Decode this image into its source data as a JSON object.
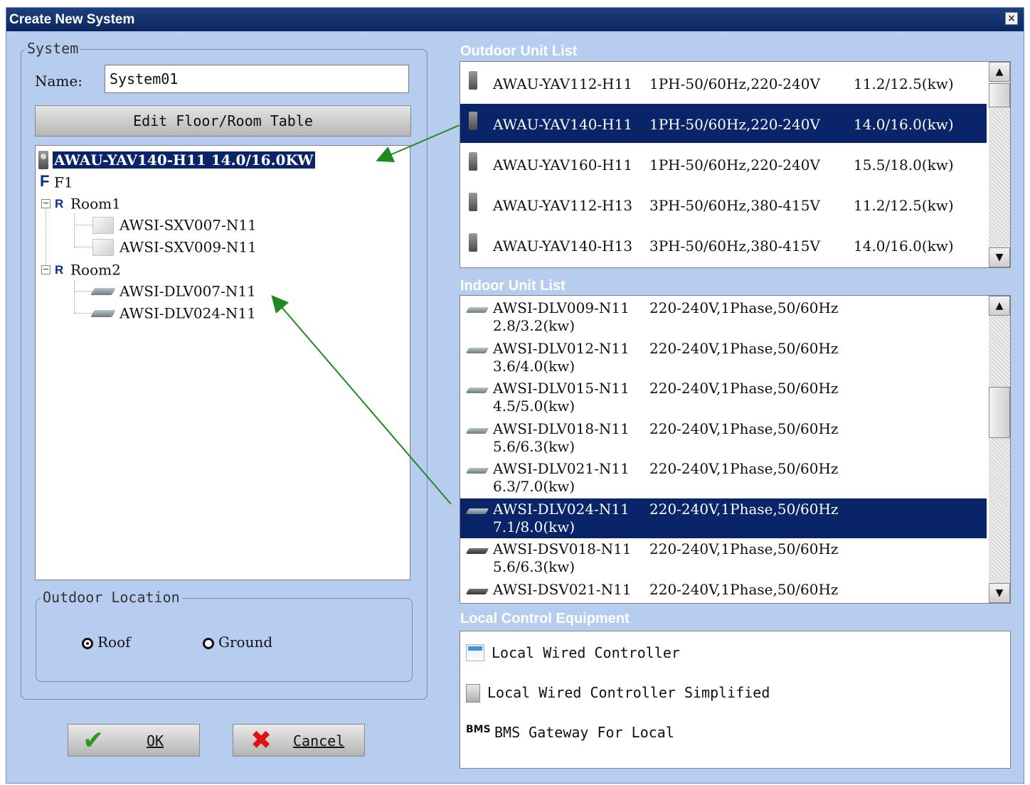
{
  "window": {
    "title": "Create New System",
    "close_label": "×"
  },
  "system_group": {
    "legend": "System",
    "name_label": "Name:",
    "name_value": "System01",
    "edit_button": "Edit Floor/Room Table"
  },
  "tree": {
    "outdoor_node": "AWAU-YAV140-H11  14.0/16.0KW",
    "floor_badge": "F",
    "floor_label": "F1",
    "rooms": [
      {
        "badge": "R",
        "label": "Room1",
        "expander": "−",
        "units": [
          "AWSI-SXV007-N11",
          "AWSI-SXV009-N11"
        ]
      },
      {
        "badge": "R",
        "label": "Room2",
        "expander": "−",
        "units": [
          "AWSI-DLV007-N11",
          "AWSI-DLV024-N11"
        ]
      }
    ]
  },
  "outdoor_location": {
    "legend": "Outdoor Location",
    "options": [
      {
        "label": "Roof",
        "checked": true
      },
      {
        "label": "Ground",
        "checked": false
      }
    ]
  },
  "buttons": {
    "ok": "OK",
    "cancel": "Cancel"
  },
  "outdoor_list": {
    "title": "Outdoor Unit List",
    "items": [
      {
        "model": "AWAU-YAV112-H11",
        "power": "1PH-50/60Hz,220-240V",
        "capacity": "11.2/12.5(kw)",
        "selected": false
      },
      {
        "model": "AWAU-YAV140-H11",
        "power": "1PH-50/60Hz,220-240V",
        "capacity": "14.0/16.0(kw)",
        "selected": true
      },
      {
        "model": "AWAU-YAV160-H11",
        "power": "1PH-50/60Hz,220-240V",
        "capacity": "15.5/18.0(kw)",
        "selected": false
      },
      {
        "model": "AWAU-YAV112-H13",
        "power": "3PH-50/60Hz,380-415V",
        "capacity": "11.2/12.5(kw)",
        "selected": false
      },
      {
        "model": "AWAU-YAV140-H13",
        "power": "3PH-50/60Hz,380-415V",
        "capacity": "14.0/16.0(kw)",
        "selected": false
      }
    ]
  },
  "indoor_list": {
    "title": "Indoor Unit List",
    "items": [
      {
        "model": "AWSI-DLV009-N11",
        "power": "220-240V,1Phase,50/60Hz",
        "capacity": "2.8/3.2(kw)",
        "selected": false
      },
      {
        "model": "AWSI-DLV012-N11",
        "power": "220-240V,1Phase,50/60Hz",
        "capacity": "3.6/4.0(kw)",
        "selected": false
      },
      {
        "model": "AWSI-DLV015-N11",
        "power": "220-240V,1Phase,50/60Hz",
        "capacity": "4.5/5.0(kw)",
        "selected": false
      },
      {
        "model": "AWSI-DLV018-N11",
        "power": "220-240V,1Phase,50/60Hz",
        "capacity": "5.6/6.3(kw)",
        "selected": false
      },
      {
        "model": "AWSI-DLV021-N11",
        "power": "220-240V,1Phase,50/60Hz",
        "capacity": "6.3/7.0(kw)",
        "selected": false
      },
      {
        "model": "AWSI-DLV024-N11",
        "power": "220-240V,1Phase,50/60Hz",
        "capacity": "7.1/8.0(kw)",
        "selected": true
      },
      {
        "model": "AWSI-DSV018-N11",
        "power": "220-240V,1Phase,50/60Hz",
        "capacity": "5.6/6.3(kw)",
        "selected": false
      },
      {
        "model": "AWSI-DSV021-N11",
        "power": "220-240V,1Phase,50/60Hz",
        "capacity": "",
        "selected": false
      }
    ]
  },
  "local_control": {
    "title": "Local Control Equipment",
    "items": [
      {
        "label": "Local Wired Controller",
        "icon": "wired-controller-icon"
      },
      {
        "label": "Local Wired Controller Simplified",
        "icon": "simplified-controller-icon"
      },
      {
        "label": "BMS Gateway For Local",
        "icon": "bms-icon",
        "icon_text": "BMS"
      }
    ]
  },
  "scroll": {
    "up": "▲",
    "down": "▼"
  },
  "colors": {
    "selection": "#0a246a",
    "window_bg": "#b7cdf0",
    "titlebar": "#0a2660",
    "arrow": "#1e8a1e"
  }
}
